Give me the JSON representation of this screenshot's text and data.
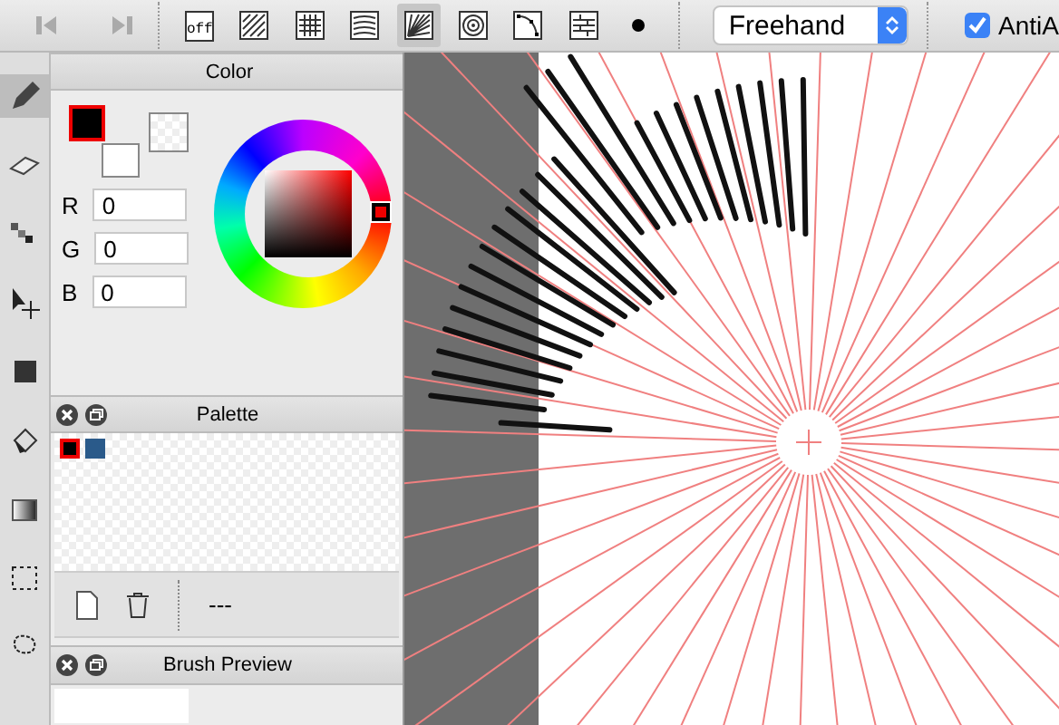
{
  "toolbar": {
    "patterns": [
      {
        "kind": "off",
        "label": "off",
        "selected": false
      },
      {
        "kind": "diagonal",
        "selected": false
      },
      {
        "kind": "grid",
        "selected": false
      },
      {
        "kind": "wavy",
        "selected": false
      },
      {
        "kind": "radial",
        "selected": true
      },
      {
        "kind": "concentric",
        "selected": false
      },
      {
        "kind": "curve",
        "selected": false
      },
      {
        "kind": "brick",
        "selected": false
      },
      {
        "kind": "dot",
        "selected": false
      }
    ],
    "mode": {
      "value": "Freehand"
    },
    "antialias": {
      "label": "AntiA",
      "checked": true
    }
  },
  "tools": [
    {
      "kind": "pencil",
      "selected": true
    },
    {
      "kind": "eraser",
      "selected": false
    },
    {
      "kind": "pixels",
      "selected": false
    },
    {
      "kind": "move",
      "selected": false
    },
    {
      "kind": "fill",
      "selected": false
    },
    {
      "kind": "bucket",
      "selected": false
    },
    {
      "kind": "gradient",
      "selected": false
    },
    {
      "kind": "select",
      "selected": false
    },
    {
      "kind": "lasso",
      "selected": false
    }
  ],
  "color_panel": {
    "title": "Color",
    "channels": [
      {
        "label": "R",
        "value": "0"
      },
      {
        "label": "G",
        "value": "0"
      },
      {
        "label": "B",
        "value": "0"
      }
    ]
  },
  "palette_panel": {
    "title": "Palette",
    "swatches": [
      {
        "color": "#000000",
        "selected": true
      },
      {
        "color": "#2a5a8a",
        "selected": false
      }
    ],
    "footer": "---"
  },
  "brush_preview_panel": {
    "title": "Brush Preview"
  }
}
